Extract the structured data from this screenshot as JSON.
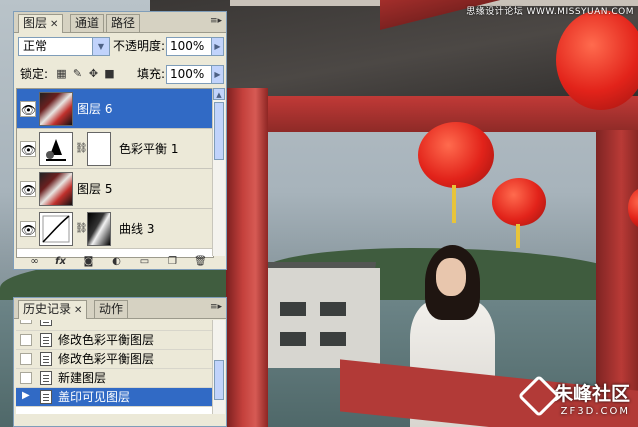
{
  "watermark": {
    "top": "思缘设计论坛 WWW.MISSYUAN.COM",
    "logo_text": "朱峰社区",
    "logo_sub": "ZF3D.COM"
  },
  "layers_panel": {
    "tabs": [
      {
        "label": "图层",
        "closable": true,
        "active": true
      },
      {
        "label": "通道",
        "closable": false,
        "active": false
      },
      {
        "label": "路径",
        "closable": false,
        "active": false
      }
    ],
    "blend_mode": "正常",
    "opacity_label": "不透明度:",
    "opacity_value": "100%",
    "lock_label": "锁定:",
    "fill_label": "填充:",
    "fill_value": "100%",
    "layers": [
      {
        "name": "图层 6",
        "selected": true,
        "type": "pixel"
      },
      {
        "name": "色彩平衡 1",
        "selected": false,
        "type": "adjustment"
      },
      {
        "name": "图层 5",
        "selected": false,
        "type": "pixel"
      },
      {
        "name": "曲线 3",
        "selected": false,
        "type": "adjustment"
      }
    ],
    "bottom_icons": [
      "link-icon",
      "fx-icon",
      "mask-icon",
      "adjustment-icon",
      "folder-icon",
      "new-layer-icon",
      "trash-icon"
    ],
    "fx_label": "fx"
  },
  "history_panel": {
    "tabs": [
      {
        "label": "历史记录",
        "closable": true,
        "active": true
      },
      {
        "label": "动作",
        "closable": false,
        "active": false
      }
    ],
    "items": [
      {
        "label": "修改色彩平衡图层",
        "selected": false
      },
      {
        "label": "修改色彩平衡图层",
        "selected": false
      },
      {
        "label": "新建图层",
        "selected": false
      },
      {
        "label": "盖印可见图层",
        "selected": true
      }
    ]
  },
  "colors": {
    "selection": "#316ac5",
    "panel_bg": "#ece9d8",
    "border": "#7f9db9"
  }
}
